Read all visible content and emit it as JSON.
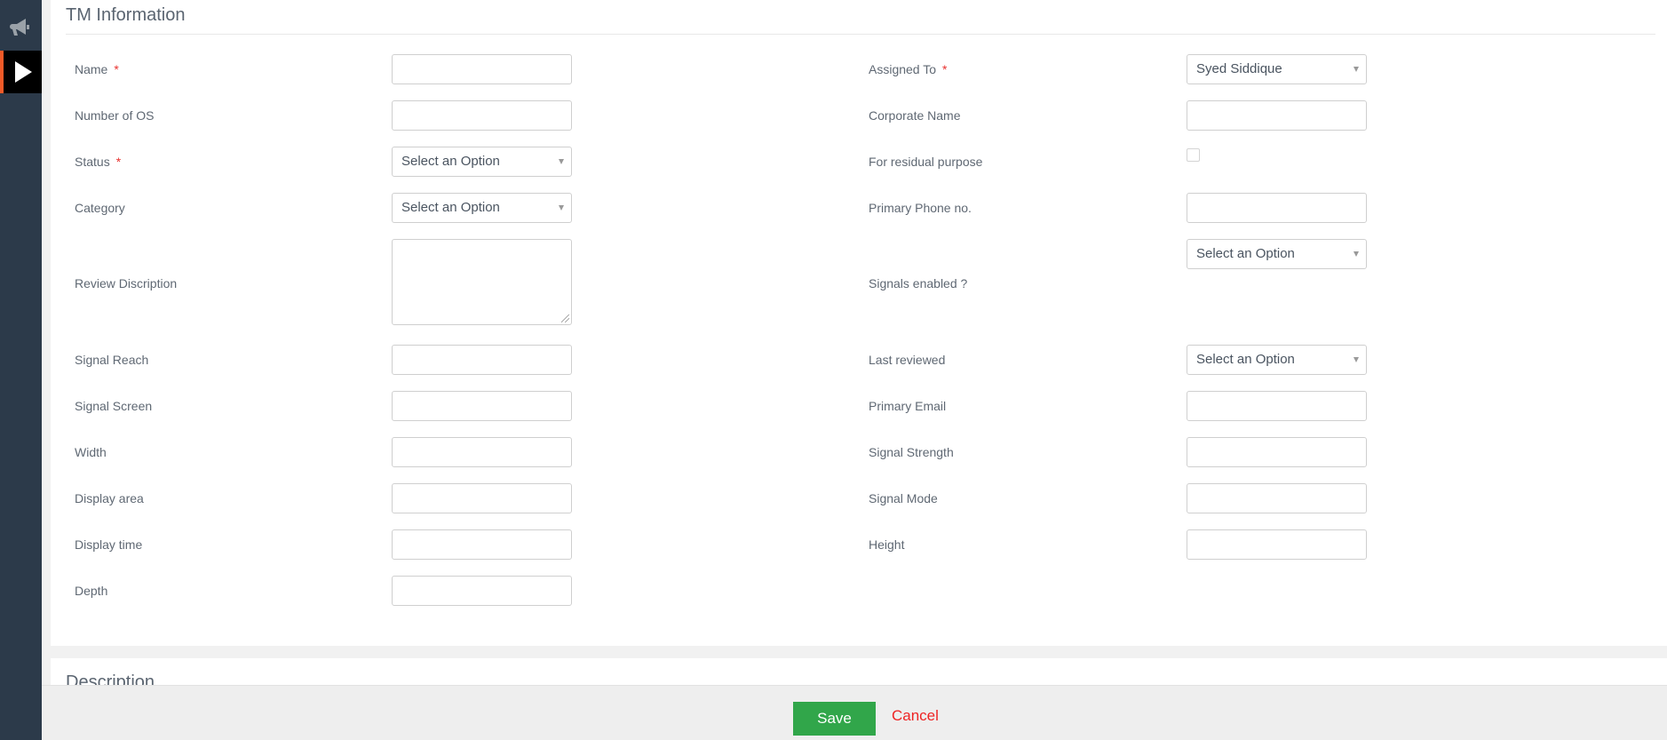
{
  "sidebar": {
    "items": [
      {
        "icon": "megaphone-icon",
        "active": false
      },
      {
        "icon": "play-icon",
        "active": true
      }
    ],
    "active_accent": "#f05a28"
  },
  "section": {
    "title": "TM Information"
  },
  "left_fields": [
    {
      "label": "Name",
      "required": true,
      "type": "text",
      "value": ""
    },
    {
      "label": "Number of OS",
      "required": false,
      "type": "text",
      "value": ""
    },
    {
      "label": "Status",
      "required": true,
      "type": "select",
      "value": "Select an Option"
    },
    {
      "label": "Category",
      "required": false,
      "type": "select",
      "value": "Select an Option"
    },
    {
      "label": "Review Discription",
      "required": false,
      "type": "textarea",
      "value": ""
    },
    {
      "label": "Signal Reach",
      "required": false,
      "type": "text",
      "value": ""
    },
    {
      "label": "Signal Screen",
      "required": false,
      "type": "text",
      "value": ""
    },
    {
      "label": "Width",
      "required": false,
      "type": "text",
      "value": ""
    },
    {
      "label": "Display area",
      "required": false,
      "type": "text",
      "value": ""
    },
    {
      "label": "Display time",
      "required": false,
      "type": "text",
      "value": ""
    },
    {
      "label": "Depth",
      "required": false,
      "type": "text",
      "value": ""
    }
  ],
  "right_fields": [
    {
      "label": "Assigned To",
      "required": true,
      "type": "select",
      "value": "Syed Siddique"
    },
    {
      "label": "Corporate Name",
      "required": false,
      "type": "text",
      "value": ""
    },
    {
      "label": "For residual purpose",
      "required": false,
      "type": "checkbox",
      "checked": false
    },
    {
      "label": "Primary Phone no.",
      "required": false,
      "type": "text",
      "value": ""
    },
    {
      "label": "Signals enabled ?",
      "required": false,
      "type": "select",
      "value": "Select an Option"
    },
    {
      "label": "Last reviewed",
      "required": false,
      "type": "select",
      "value": "Select an Option"
    },
    {
      "label": "Primary Email",
      "required": false,
      "type": "text",
      "value": ""
    },
    {
      "label": "Signal Strength",
      "required": false,
      "type": "text",
      "value": ""
    },
    {
      "label": "Signal Mode",
      "required": false,
      "type": "text",
      "value": ""
    },
    {
      "label": "Height",
      "required": false,
      "type": "text",
      "value": ""
    }
  ],
  "description_section": {
    "title": "Description"
  },
  "footer": {
    "save_label": "Save",
    "cancel_label": "Cancel",
    "save_color": "#31a64a",
    "cancel_color": "#ee2424"
  }
}
